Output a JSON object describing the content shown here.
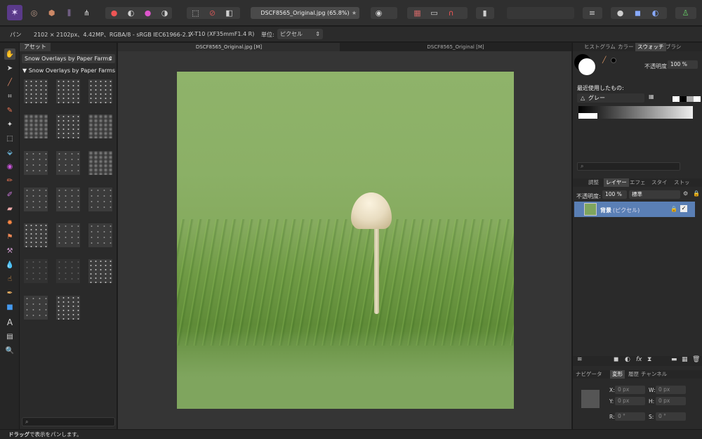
{
  "toolbar": {
    "doc_title": "DSCF8565_Original.jpg (65.8%)"
  },
  "context": {
    "tool": "パン",
    "image_info": "2102 × 2102px、4.42MP、RGBA/8 - sRGB IEC61966-2.1",
    "camera": "X-T10 (XF35mmF1.4 R)",
    "unit_label": "単位:",
    "unit_value": "ピクセル"
  },
  "assets": {
    "tab": "アセット",
    "category": "Snow Overlays by Paper Farms",
    "subcategory": "Snow Overlays by Paper Farms"
  },
  "doc_tabs": [
    "DSCF8565_Original.jpg [M]",
    "DSCF8565_Original [M]"
  ],
  "right": {
    "top_tabs": [
      "ヒストグラム",
      "カラー",
      "スウォッチ",
      "ブラシ"
    ],
    "opacity_label": "不透明度:",
    "opacity_value": "100 %",
    "recent_label": "最近使用したもの:",
    "palette": "グレー",
    "layer_tabs": [
      "調整",
      "レイヤー",
      "エフェ",
      "スタイ",
      "ストッ"
    ],
    "layer_opacity_label": "不透明度:",
    "layer_opacity_value": "100 %",
    "blend": "標準",
    "layer_name": "背景",
    "layer_type": "(ピクセル)",
    "bottom_tabs": [
      "ナビゲータ",
      "変形",
      "履歴",
      "チャンネル"
    ],
    "x_label": "X:",
    "y_label": "Y:",
    "w_label": "W:",
    "h_label": "H:",
    "r_label": "R:",
    "s_label": "S:",
    "x_val": "0 px",
    "y_val": "0 px",
    "w_val": "0 px",
    "h_val": "0 px",
    "r_val": "0 °",
    "s_val": "0 °"
  },
  "status": {
    "bold": "ドラッグ",
    "text": "で表示をパンします。"
  }
}
